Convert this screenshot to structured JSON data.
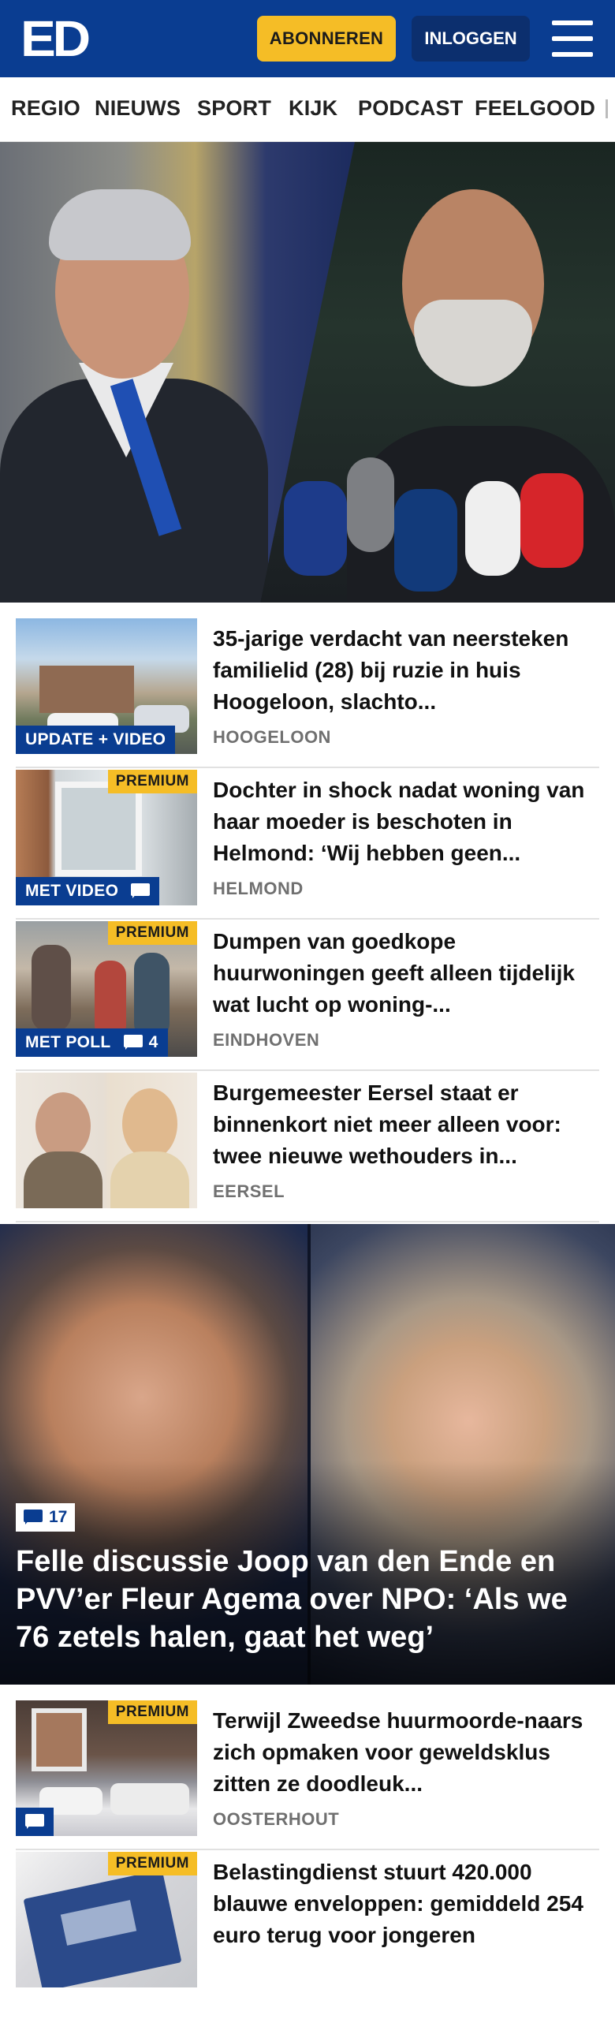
{
  "header": {
    "logo": "ED",
    "subscribe_label": "ABONNEREN",
    "login_label": "INLOGGEN"
  },
  "nav": {
    "items": [
      "REGIO",
      "NIEUWS",
      "SPORT",
      "KIJK",
      "PODCAST",
      "FEELGOOD"
    ]
  },
  "colors": {
    "brand_blue": "#0a3d91",
    "accent_yellow": "#f5bd26"
  },
  "articles": [
    {
      "title": "35-jarige verdacht van neersteken familielid (28) bij ruzie in huis Hoogeloon, slachto...",
      "location": "HOOGELOON",
      "badge": "UPDATE + VIDEO",
      "premium": null,
      "comments": null
    },
    {
      "title": "Dochter in shock nadat woning van haar moeder is beschoten in Helmond: ‘Wij hebben geen...",
      "location": "HELMOND",
      "badge": "MET VIDEO",
      "premium": "PREMIUM",
      "comments": ""
    },
    {
      "title": "Dumpen van goedkope huurwoningen geeft alleen tijdelijk wat lucht op woning-...",
      "location": "EINDHOVEN",
      "badge": "MET POLL",
      "premium": "PREMIUM",
      "comments": "4"
    },
    {
      "title": "Burgemeester Eersel staat er binnenkort niet meer alleen voor: twee nieuwe wethouders in...",
      "location": "EERSEL",
      "badge": null,
      "premium": null,
      "comments": null
    }
  ],
  "feature": {
    "comments": "17",
    "title": "Felle discussie Joop van den Ende en PVV’er Fleur Agema over NPO: ‘Als we 76 zetels halen, gaat het weg’"
  },
  "articles2": [
    {
      "title": "Terwijl Zweedse huurmoorde-naars zich opmaken voor geweldsklus zitten ze doodleuk...",
      "location": "OOSTERHOUT",
      "premium": "PREMIUM"
    },
    {
      "title": "Belastingdienst stuurt 420.000 blauwe enveloppen: gemiddeld 254 euro terug voor jongeren",
      "location": "",
      "premium": "PREMIUM"
    }
  ]
}
